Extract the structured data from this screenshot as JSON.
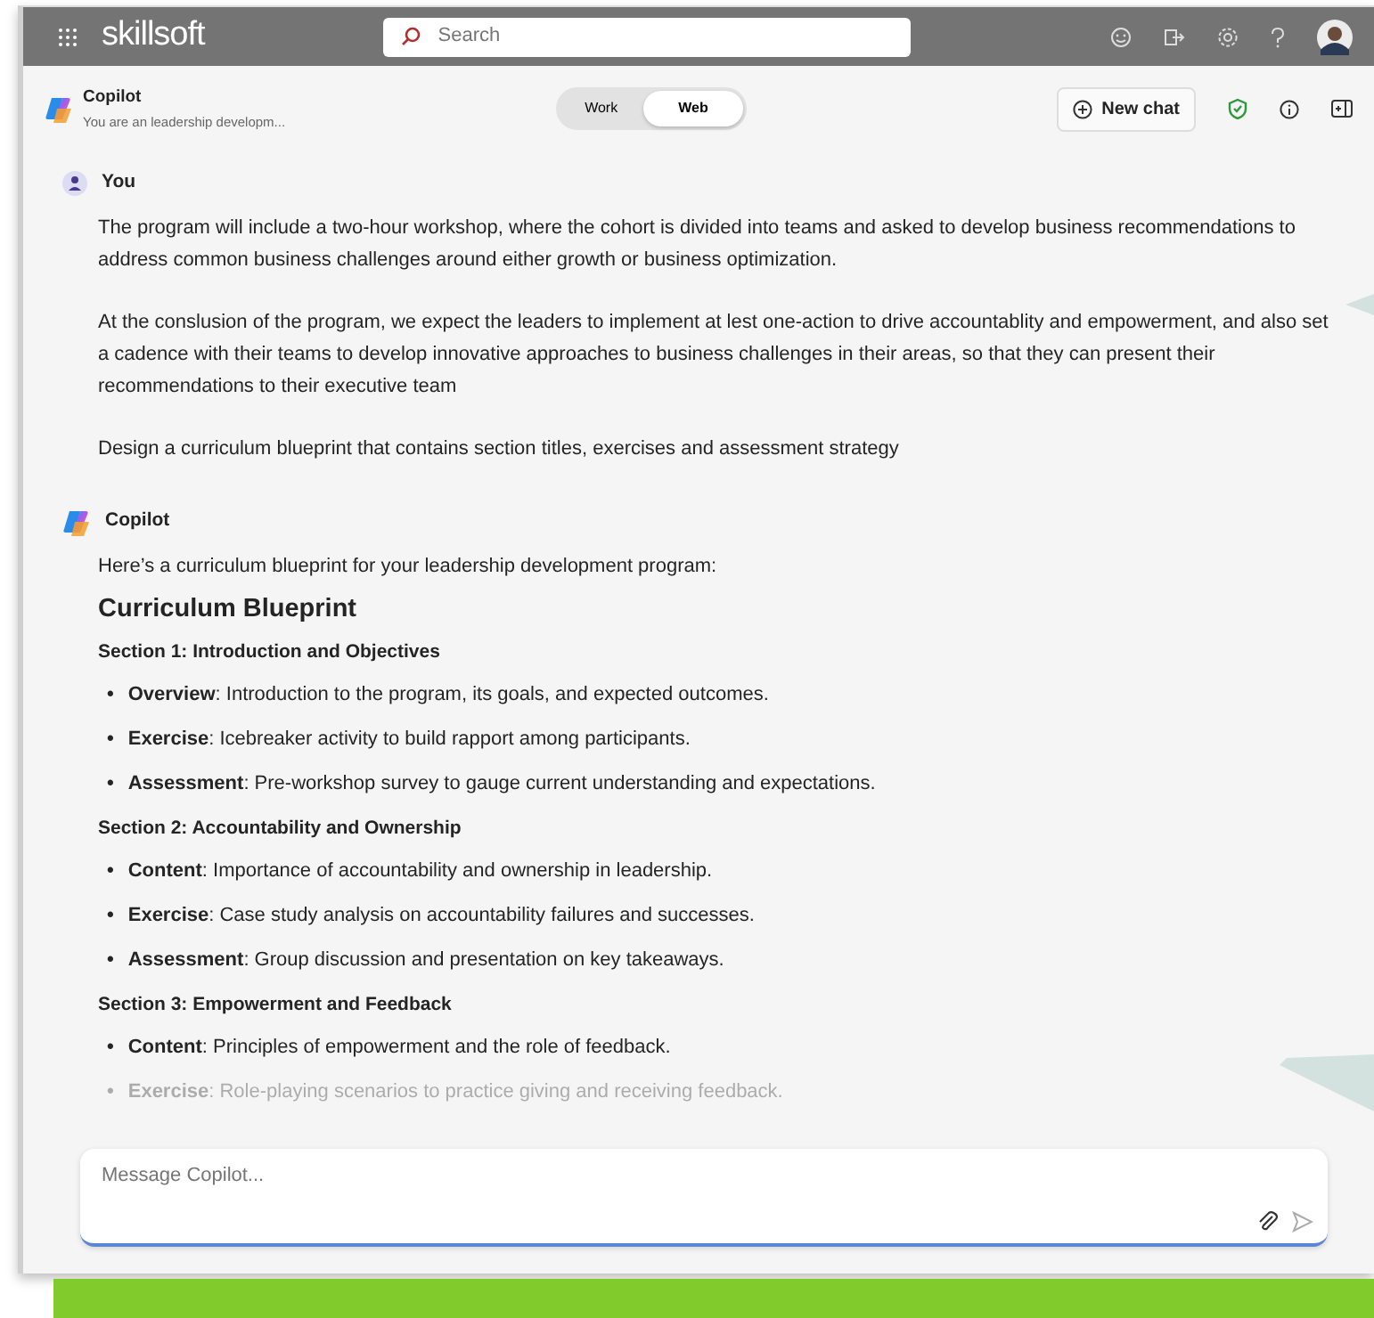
{
  "topbar": {
    "logo": "skillsoft",
    "search": {
      "placeholder": "Search"
    }
  },
  "header": {
    "title": "Copilot",
    "subtitle": "You are an leadership developm...",
    "modes": [
      {
        "label": "Work",
        "selected": false
      },
      {
        "label": "Web",
        "selected": true
      }
    ],
    "new_chat": "New chat"
  },
  "messages": [
    {
      "kind": "user",
      "author": "You",
      "paragraphs": [
        "The program will include a two-hour workshop, where the cohort is divided into teams and asked to develop business recommendations to address common business challenges around either growth or business optimization.",
        "At the conslusion of the program, we expect the leaders to implement at lest one-action to drive accountablity and empowerment, and also set a cadence with their teams to develop innovative approaches to business challenges in their areas, so that they can present their recommendations to their executive team",
        "Design a curriculum blueprint that contains section titles, exercises and assessment strategy"
      ]
    },
    {
      "kind": "bot",
      "author": "Copilot",
      "intro": "Here’s a curriculum blueprint for your leadership development program:",
      "heading": "Curriculum Blueprint",
      "sections": [
        {
          "title": "Section 1: Introduction and Objectives",
          "items": [
            {
              "bullet": "•",
              "text": "**Overview**: Introduction to the program, its goals, and expected outcomes.",
              "faded": false
            },
            {
              "bullet": "•",
              "text": "**Exercise**: Icebreaker activity to build rapport among participants.",
              "faded": false
            },
            {
              "bullet": "•",
              "text": "**Assessment**: Pre-workshop survey to gauge current understanding and expectations.",
              "faded": false
            }
          ]
        },
        {
          "title": "Section 2: Accountability and Ownership",
          "items": [
            {
              "bullet": "•",
              "text": "**Content**: Importance of accountability and ownership in leadership.",
              "faded": false
            },
            {
              "bullet": "•",
              "text": "**Exercise**: Case study analysis on accountability failures and successes.",
              "faded": false
            },
            {
              "bullet": "•",
              "text": "**Assessment**: Group discussion and presentation on key takeaways.",
              "faded": false
            }
          ]
        },
        {
          "title": "Section 3: Empowerment and Feedback",
          "items": [
            {
              "bullet": "•",
              "text": "**Content**: Principles of empowerment and the role of feedback.",
              "faded": false
            },
            {
              "bullet": "•",
              "text": "**Exercise**: Role-playing scenarios to practice giving and receiving feedback.",
              "faded": true
            }
          ]
        }
      ]
    }
  ],
  "composer": {
    "placeholder": "Message Copilot..."
  }
}
